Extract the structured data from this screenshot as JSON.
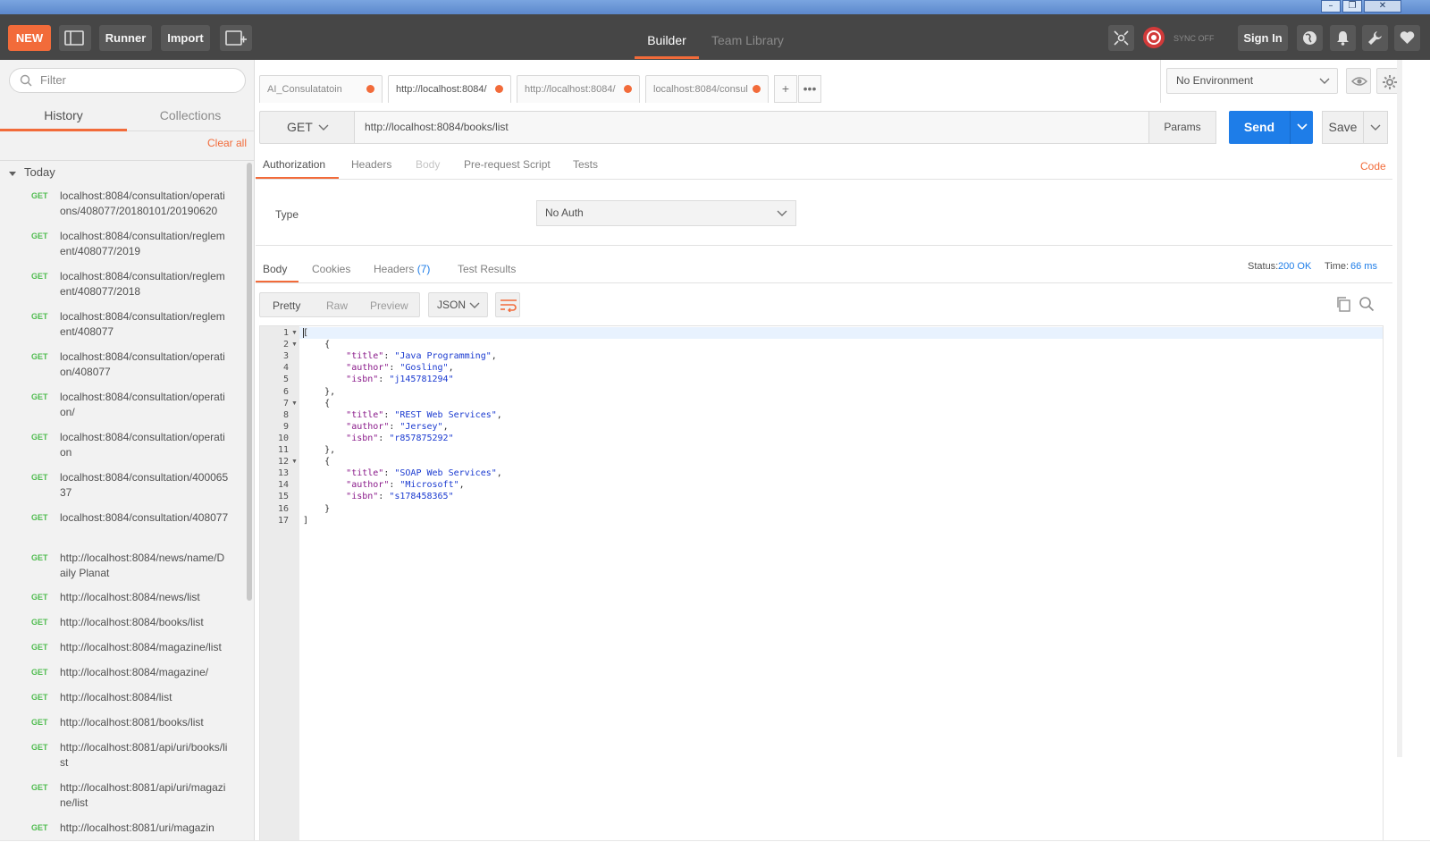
{
  "window": {
    "controls": [
      "–",
      "❐",
      "✕"
    ]
  },
  "header": {
    "new_label": "NEW",
    "runner_label": "Runner",
    "import_label": "Import",
    "tabs": [
      {
        "label": "Builder",
        "active": true
      },
      {
        "label": "Team Library",
        "active": false
      }
    ],
    "sync_label": "SYNC OFF",
    "signin_label": "Sign In",
    "accent": "#f26b3a"
  },
  "sidebar": {
    "filter_placeholder": "Filter",
    "tabs": [
      {
        "label": "History",
        "active": true
      },
      {
        "label": "Collections",
        "active": false
      }
    ],
    "clear_label": "Clear all",
    "group_label": "Today",
    "items": [
      {
        "method": "GET",
        "url": "localhost:8084/consultation/operations/408077/20180101/20190620"
      },
      {
        "method": "GET",
        "url": "localhost:8084/consultation/reglement/408077/2019"
      },
      {
        "method": "GET",
        "url": "localhost:8084/consultation/reglement/408077/2018"
      },
      {
        "method": "GET",
        "url": "localhost:8084/consultation/reglement/408077"
      },
      {
        "method": "GET",
        "url": "localhost:8084/consultation/operation/408077"
      },
      {
        "method": "GET",
        "url": "localhost:8084/consultation/operation/"
      },
      {
        "method": "GET",
        "url": "localhost:8084/consultation/operation"
      },
      {
        "method": "GET",
        "url": "localhost:8084/consultation/40006537"
      },
      {
        "method": "GET",
        "url": "localhost:8084/consultation/408077"
      },
      {
        "method": "GET",
        "url": "http://localhost:8084/news/name/Daily Planat"
      },
      {
        "method": "GET",
        "url": "http://localhost:8084/news/list"
      },
      {
        "method": "GET",
        "url": "http://localhost:8084/books/list"
      },
      {
        "method": "GET",
        "url": "http://localhost:8084/magazine/list"
      },
      {
        "method": "GET",
        "url": "http://localhost:8084/magazine/"
      },
      {
        "method": "GET",
        "url": "http://localhost:8084/list"
      },
      {
        "method": "GET",
        "url": "http://localhost:8081/books/list"
      },
      {
        "method": "GET",
        "url": "http://localhost:8081/api/uri/books/list"
      },
      {
        "method": "GET",
        "url": "http://localhost:8081/api/uri/magazine/list"
      },
      {
        "method": "GET",
        "url": "http://localhost:8081/uri/magazin"
      }
    ],
    "method_color": "#4fbc4f"
  },
  "request_tabs": [
    {
      "label": "AI_Consulatatoin",
      "active": false
    },
    {
      "label": "http://localhost:8084/",
      "active": true
    },
    {
      "label": "http://localhost:8084/",
      "active": false
    },
    {
      "label": "localhost:8084/consul",
      "active": false
    }
  ],
  "environment": {
    "selected": "No Environment"
  },
  "request": {
    "method": "GET",
    "url": "http://localhost:8084/books/list",
    "params_label": "Params",
    "send_label": "Send",
    "save_label": "Save",
    "send_color": "#1e7de8"
  },
  "request_subtabs": [
    "Authorization",
    "Headers",
    "Body",
    "Pre-request Script",
    "Tests"
  ],
  "code_label": "Code",
  "auth": {
    "type_label": "Type",
    "selected": "No Auth"
  },
  "response": {
    "tabs": [
      "Body",
      "Cookies",
      "Headers",
      "Test Results"
    ],
    "headers_count": "(7)",
    "status_label": "Status:",
    "status_value": "200 OK",
    "time_label": "Time:",
    "time_value": "66 ms",
    "view_modes": [
      "Pretty",
      "Raw",
      "Preview"
    ],
    "format": "JSON",
    "code_lines": [
      "[",
      "    {",
      "        \"title\": \"Java Programming\",",
      "        \"author\": \"Gosling\",",
      "        \"isbn\": \"j145781294\"",
      "    },",
      "    {",
      "        \"title\": \"REST Web Services\",",
      "        \"author\": \"Jersey\",",
      "        \"isbn\": \"r857875292\"",
      "    },",
      "    {",
      "        \"title\": \"SOAP Web Services\",",
      "        \"author\": \"Microsoft\",",
      "        \"isbn\": \"s178458365\"",
      "    }",
      "]"
    ],
    "fold_lines": [
      1,
      2,
      7,
      12
    ]
  }
}
